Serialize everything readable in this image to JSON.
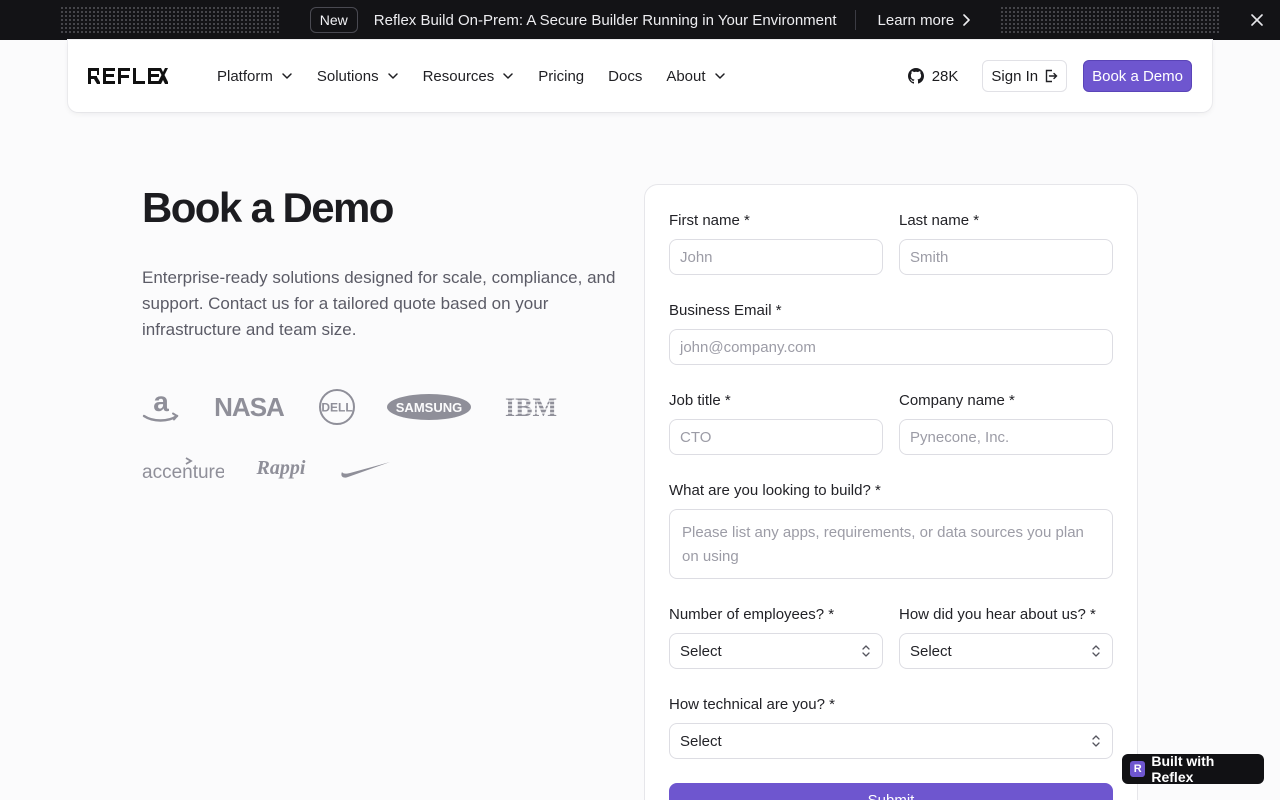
{
  "announcement": {
    "badge": "New",
    "text": "Reflex Build On-Prem: A Secure Builder Running in Your Environment",
    "link_label": "Learn more"
  },
  "nav": {
    "brand": "REFLEX",
    "items": [
      {
        "label": "Platform",
        "has_dropdown": true
      },
      {
        "label": "Solutions",
        "has_dropdown": true
      },
      {
        "label": "Resources",
        "has_dropdown": true
      },
      {
        "label": "Pricing",
        "has_dropdown": false
      },
      {
        "label": "Docs",
        "has_dropdown": false
      },
      {
        "label": "About",
        "has_dropdown": true
      }
    ],
    "github_stars": "28K",
    "sign_in": "Sign In",
    "book_demo": "Book a Demo"
  },
  "hero": {
    "title": "Book a Demo",
    "description": "Enterprise-ready solutions designed for scale, compliance, and support. Contact us for a tailored quote based on your infrastructure and team size."
  },
  "customer_logos": {
    "row1": [
      "amazon",
      "nasa",
      "dell",
      "samsung",
      "ibm"
    ],
    "row2": [
      "accenture",
      "rappi",
      "nike"
    ],
    "text": {
      "nasa": "NASA",
      "dell": "DELL",
      "samsung": "SAMSUNG",
      "ibm": "IBM",
      "accenture": "accenture",
      "rappi": "Rappi"
    }
  },
  "form": {
    "first_name": {
      "label": "First name *",
      "placeholder": "John"
    },
    "last_name": {
      "label": "Last name *",
      "placeholder": "Smith"
    },
    "email": {
      "label": "Business Email *",
      "placeholder": "john@company.com"
    },
    "job_title": {
      "label": "Job title *",
      "placeholder": "CTO"
    },
    "company": {
      "label": "Company name *",
      "placeholder": "Pynecone, Inc."
    },
    "build": {
      "label": "What are you looking to build? *",
      "placeholder": "Please list any apps, requirements, or data sources you plan on using"
    },
    "employees": {
      "label": "Number of employees? *",
      "value": "Select"
    },
    "heard": {
      "label": "How did you hear about us? *",
      "value": "Select"
    },
    "technical": {
      "label": "How technical are you? *",
      "value": "Select"
    },
    "submit": "Submit"
  },
  "badge": {
    "text": "Built with Reflex",
    "mark": "R"
  },
  "colors": {
    "accent": "#6e56cf",
    "announcement_bg": "#131316",
    "page_bg": "#fbfbfc"
  }
}
